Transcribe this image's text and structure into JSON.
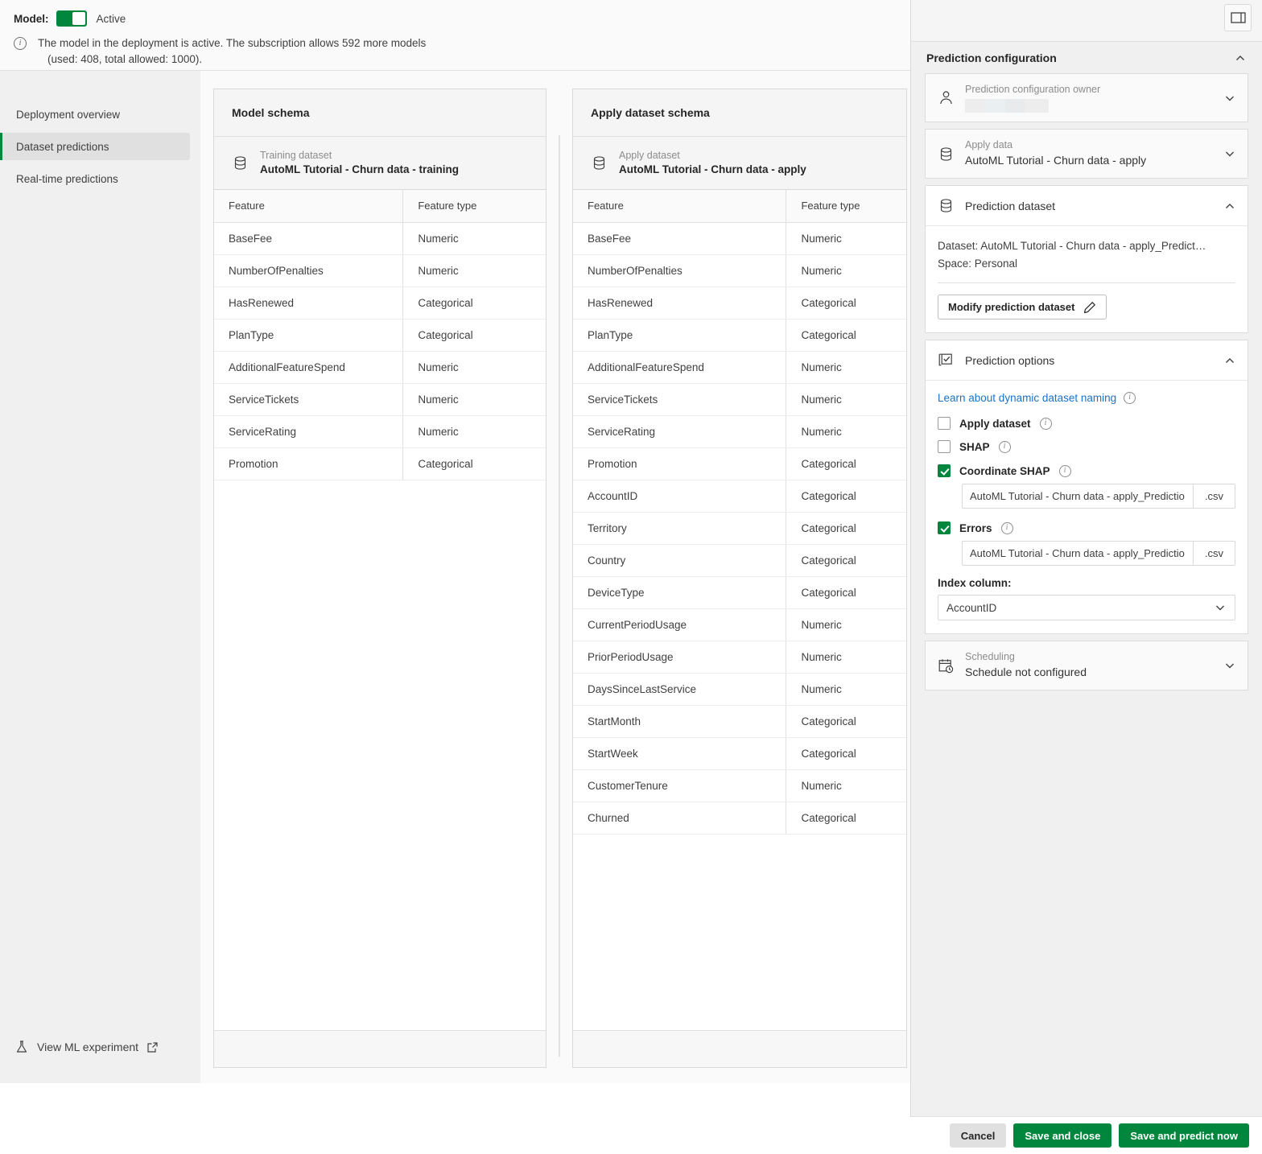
{
  "status": {
    "model_label": "Model:",
    "toggle_state": "Active",
    "toggle_on": true,
    "info_line1": "The model in the deployment is active. The subscription allows 592 more models",
    "info_line2": "(used: 408, total allowed: 1000)."
  },
  "sidebar": {
    "items": [
      {
        "label": "Deployment overview",
        "active": false
      },
      {
        "label": "Dataset predictions",
        "active": true
      },
      {
        "label": "Real-time predictions",
        "active": false
      }
    ],
    "ml_experiment_link": "View ML experiment"
  },
  "model_schema": {
    "title": "Model schema",
    "dataset_kind": "Training dataset",
    "dataset_name": "AutoML Tutorial - Churn data - training",
    "columns": [
      "Feature",
      "Feature type"
    ],
    "rows": [
      [
        "BaseFee",
        "Numeric"
      ],
      [
        "NumberOfPenalties",
        "Numeric"
      ],
      [
        "HasRenewed",
        "Categorical"
      ],
      [
        "PlanType",
        "Categorical"
      ],
      [
        "AdditionalFeatureSpend",
        "Numeric"
      ],
      [
        "ServiceTickets",
        "Numeric"
      ],
      [
        "ServiceRating",
        "Numeric"
      ],
      [
        "Promotion",
        "Categorical"
      ]
    ]
  },
  "apply_schema": {
    "title": "Apply dataset schema",
    "dataset_kind": "Apply dataset",
    "dataset_name": "AutoML Tutorial - Churn data - apply",
    "columns": [
      "Feature",
      "Feature type"
    ],
    "rows": [
      [
        "BaseFee",
        "Numeric"
      ],
      [
        "NumberOfPenalties",
        "Numeric"
      ],
      [
        "HasRenewed",
        "Categorical"
      ],
      [
        "PlanType",
        "Categorical"
      ],
      [
        "AdditionalFeatureSpend",
        "Numeric"
      ],
      [
        "ServiceTickets",
        "Numeric"
      ],
      [
        "ServiceRating",
        "Numeric"
      ],
      [
        "Promotion",
        "Categorical"
      ],
      [
        "AccountID",
        "Categorical"
      ],
      [
        "Territory",
        "Categorical"
      ],
      [
        "Country",
        "Categorical"
      ],
      [
        "DeviceType",
        "Categorical"
      ],
      [
        "CurrentPeriodUsage",
        "Numeric"
      ],
      [
        "PriorPeriodUsage",
        "Numeric"
      ],
      [
        "DaysSinceLastService",
        "Numeric"
      ],
      [
        "StartMonth",
        "Categorical"
      ],
      [
        "StartWeek",
        "Categorical"
      ],
      [
        "CustomerTenure",
        "Numeric"
      ],
      [
        "Churned",
        "Categorical"
      ]
    ]
  },
  "right_panel": {
    "header_title": "Prediction configuration",
    "owner": {
      "label": "Prediction configuration owner",
      "value": ""
    },
    "apply_data": {
      "label": "Apply data",
      "value": "AutoML Tutorial - Churn data - apply"
    },
    "prediction_dataset": {
      "title": "Prediction dataset",
      "dataset_line": "Dataset: AutoML Tutorial - Churn data - apply_Predict…",
      "space_line": "Space: Personal",
      "modify_button": "Modify prediction dataset"
    },
    "prediction_options": {
      "title": "Prediction options",
      "learn_link": "Learn about dynamic dataset naming",
      "checkboxes": [
        {
          "label": "Apply dataset",
          "checked": false
        },
        {
          "label": "SHAP",
          "checked": false
        },
        {
          "label": "Coordinate SHAP",
          "checked": true,
          "filename": "AutoML Tutorial - Churn data - apply_Predictio",
          "extension": ".csv"
        },
        {
          "label": "Errors",
          "checked": true,
          "filename": "AutoML Tutorial - Churn data - apply_Predictio",
          "extension": ".csv"
        }
      ],
      "index_column_label": "Index column:",
      "index_column_value": "AccountID"
    },
    "scheduling": {
      "label": "Scheduling",
      "value": "Schedule not configured"
    }
  },
  "actions": {
    "cancel": "Cancel",
    "save_and_close": "Save and close",
    "save_and_predict": "Save and predict now"
  },
  "colors": {
    "accent_green": "#00873d",
    "link_blue": "#1a73c8",
    "panel_bg": "#f0f0f0",
    "canvas_bg": "#fafafa"
  }
}
